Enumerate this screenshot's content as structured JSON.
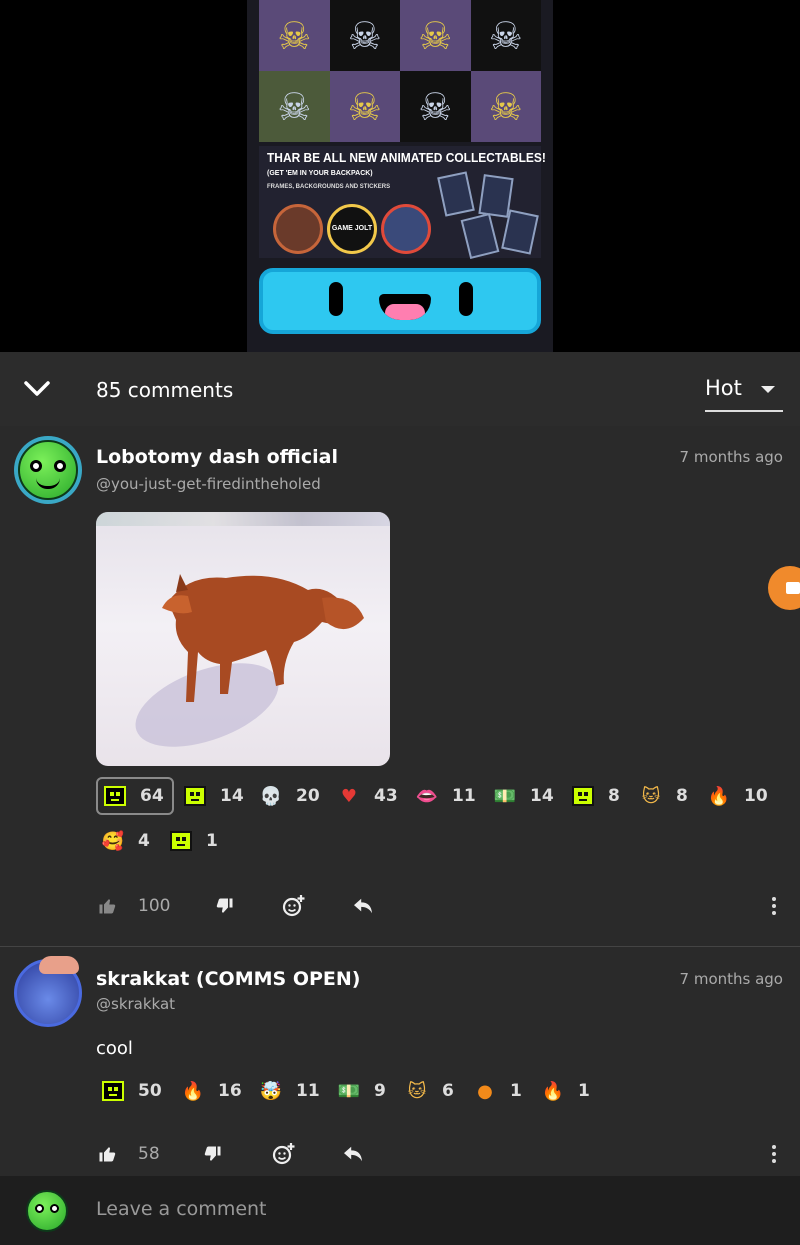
{
  "media": {
    "promo_title": "THAR BE ALL NEW ANIMATED COLLECTABLES!",
    "promo_sub": "(GET 'EM IN YOUR BACKPACK)",
    "promo_sub2": "FRAMES, BACKGROUNDS AND STICKERS",
    "badge_text": "GAME JOLT"
  },
  "header": {
    "count_label": "85 comments",
    "sort_label": "Hot"
  },
  "comments": [
    {
      "username": "Lobotomy dash official",
      "handle": "@you-just-get-firedintheholed",
      "time": "7 months ago",
      "reactions": [
        {
          "icon": "gamejolt-face-dark-icon",
          "count": "64"
        },
        {
          "icon": "gamejolt-face-icon",
          "count": "14"
        },
        {
          "icon": "pixel-skull-icon",
          "count": "20"
        },
        {
          "icon": "heart-icon",
          "count": "43"
        },
        {
          "icon": "lips-icon",
          "count": "11"
        },
        {
          "icon": "money-icon",
          "count": "14"
        },
        {
          "icon": "gamejolt-neutral-icon",
          "count": "8"
        },
        {
          "icon": "cat-face-icon",
          "count": "8"
        },
        {
          "icon": "fire-icon",
          "count": "10"
        },
        {
          "icon": "smiling-hearts-icon",
          "count": "4"
        },
        {
          "icon": "gamejolt-wink-icon",
          "count": "1"
        }
      ],
      "likes": "100"
    },
    {
      "username": "skrakkat (COMMS OPEN)",
      "handle": "@skrakkat",
      "time": "7 months ago",
      "text": "cool",
      "reactions": [
        {
          "icon": "gamejolt-face-dark-icon",
          "count": "50"
        },
        {
          "icon": "fire-icon",
          "count": "16"
        },
        {
          "icon": "mind-blown-icon",
          "count": "11"
        },
        {
          "icon": "money-icon",
          "count": "9"
        },
        {
          "icon": "cat-face-icon",
          "count": "6"
        },
        {
          "icon": "orange-icon",
          "count": "1"
        },
        {
          "icon": "flame-hand-icon",
          "count": "1"
        }
      ],
      "likes": "58"
    }
  ],
  "footer": {
    "placeholder": "Leave a comment"
  },
  "colors": {
    "background": "#2a2a2a",
    "accent_green": "#ccff00",
    "fab_orange": "#f08a2c"
  }
}
